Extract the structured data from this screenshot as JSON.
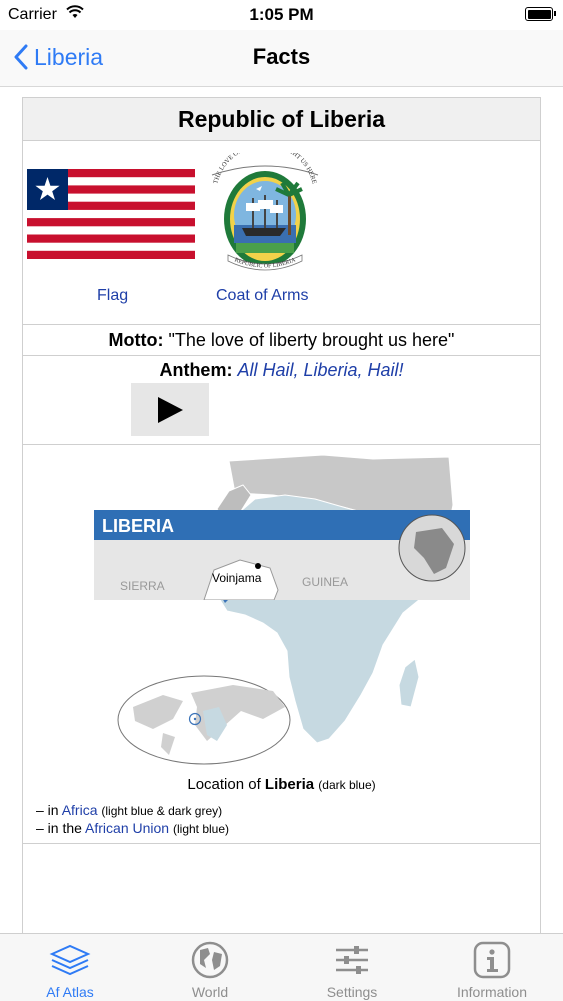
{
  "status": {
    "carrier": "Carrier",
    "time": "1:05 PM"
  },
  "nav": {
    "back_label": "Liberia",
    "title": "Facts"
  },
  "header": {
    "title": "Republic of Liberia"
  },
  "images": {
    "flag_caption": "Flag",
    "coa_caption": "Coat of Arms",
    "coa_top_text": "THE LOVE OF LIBERTY BROUGHT US HERE",
    "coa_bottom_text": "REPUBLIC OF LIBERIA"
  },
  "motto": {
    "label": "Motto:",
    "text": "\"The love of liberty brought us here\""
  },
  "anthem": {
    "label": "Anthem:",
    "title": "All Hail, Liberia, Hail!"
  },
  "map": {
    "loc_prefix": "Location of ",
    "loc_country": "Liberia",
    "loc_note": "(dark blue)",
    "line1_prefix": "– in ",
    "line1_link": "Africa",
    "line1_note": "(light blue & dark grey)",
    "line2_prefix": "– in the ",
    "line2_link": "African Union",
    "line2_note": "(light blue)"
  },
  "lower_map": {
    "title": "LIBERIA",
    "label_sierra": "SIERRA",
    "label_guinea": "GUINEA",
    "label_town": "Voinjama"
  },
  "tabs": [
    {
      "label": "Af Atlas",
      "icon": "layers-icon"
    },
    {
      "label": "World",
      "icon": "globe-icon"
    },
    {
      "label": "Settings",
      "icon": "sliders-icon"
    },
    {
      "label": "Information",
      "icon": "info-icon"
    }
  ],
  "colors": {
    "accent": "#2f7bf5",
    "link": "#1f3fa8",
    "map_africa": "#c6d9e1",
    "map_grey": "#c8c8c8",
    "liberia": "#3b73b8",
    "flag_red": "#c8102e",
    "flag_blue": "#002868"
  }
}
